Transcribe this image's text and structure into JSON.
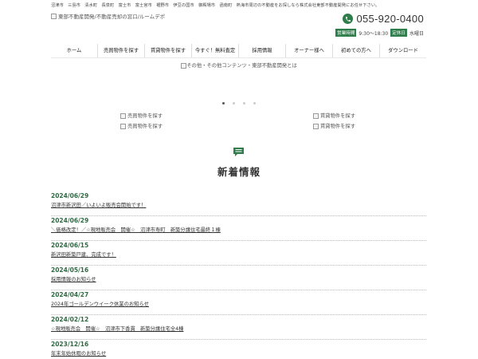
{
  "header": {
    "area_text": "沼津市　三島市　清水町　長泉町　富士市　富士宮市　裾野市　伊豆の国市　御殿場市　函南町　熱海市周辺の不動産をお探しなら株式会社東部不動産開発にお任せ下さい。",
    "logo_alt": "東部不動産開発/不動産売却の窓口/ルームデポ",
    "phone": "055-920-0400",
    "hours_label": "営業時間",
    "hours": "9:30～18:30",
    "holiday_label": "定休日",
    "holiday": "水曜日"
  },
  "nav": {
    "items": [
      "ホーム",
      "売買物件を探す",
      "賃貸物件を探す",
      "今すぐ！無料査定",
      "採用情報",
      "オーナー様へ",
      "初めての方へ",
      "ダウンロード"
    ]
  },
  "banner": {
    "alt": "その他・その他コンテンツ・東部不動産開発とは"
  },
  "categories": {
    "left": [
      "売買物件を探す",
      "売買物件を探す"
    ],
    "right": [
      "賃貸物件を探す",
      "賃貸物件を探す"
    ]
  },
  "news": {
    "title": "新着情報",
    "items": [
      {
        "date": "2024/06/29",
        "text": "沼津市新沢田／いよいよ販売会開始です！"
      },
      {
        "date": "2024/06/29",
        "text": "＼価格改定！／☆現地販売会　開催☆　沼津市寿町　新築分譲住宅最終１棟"
      },
      {
        "date": "2024/06/15",
        "text": "新沢田新築戸建、完成です！"
      },
      {
        "date": "2024/05/16",
        "text": "採用情報のお知らせ"
      },
      {
        "date": "2024/04/27",
        "text": "2024年ゴールデンウイーク休業のお知らせ"
      },
      {
        "date": "2024/02/12",
        "text": "☆現地販売会　開催☆　沼津市下香貫　新築分譲住宅全4棟"
      },
      {
        "date": "2023/12/16",
        "text": "年末年始休暇のお知らせ"
      }
    ]
  },
  "colors": {
    "accent": "#2f7d4b",
    "date_green": "#2f6a43"
  }
}
